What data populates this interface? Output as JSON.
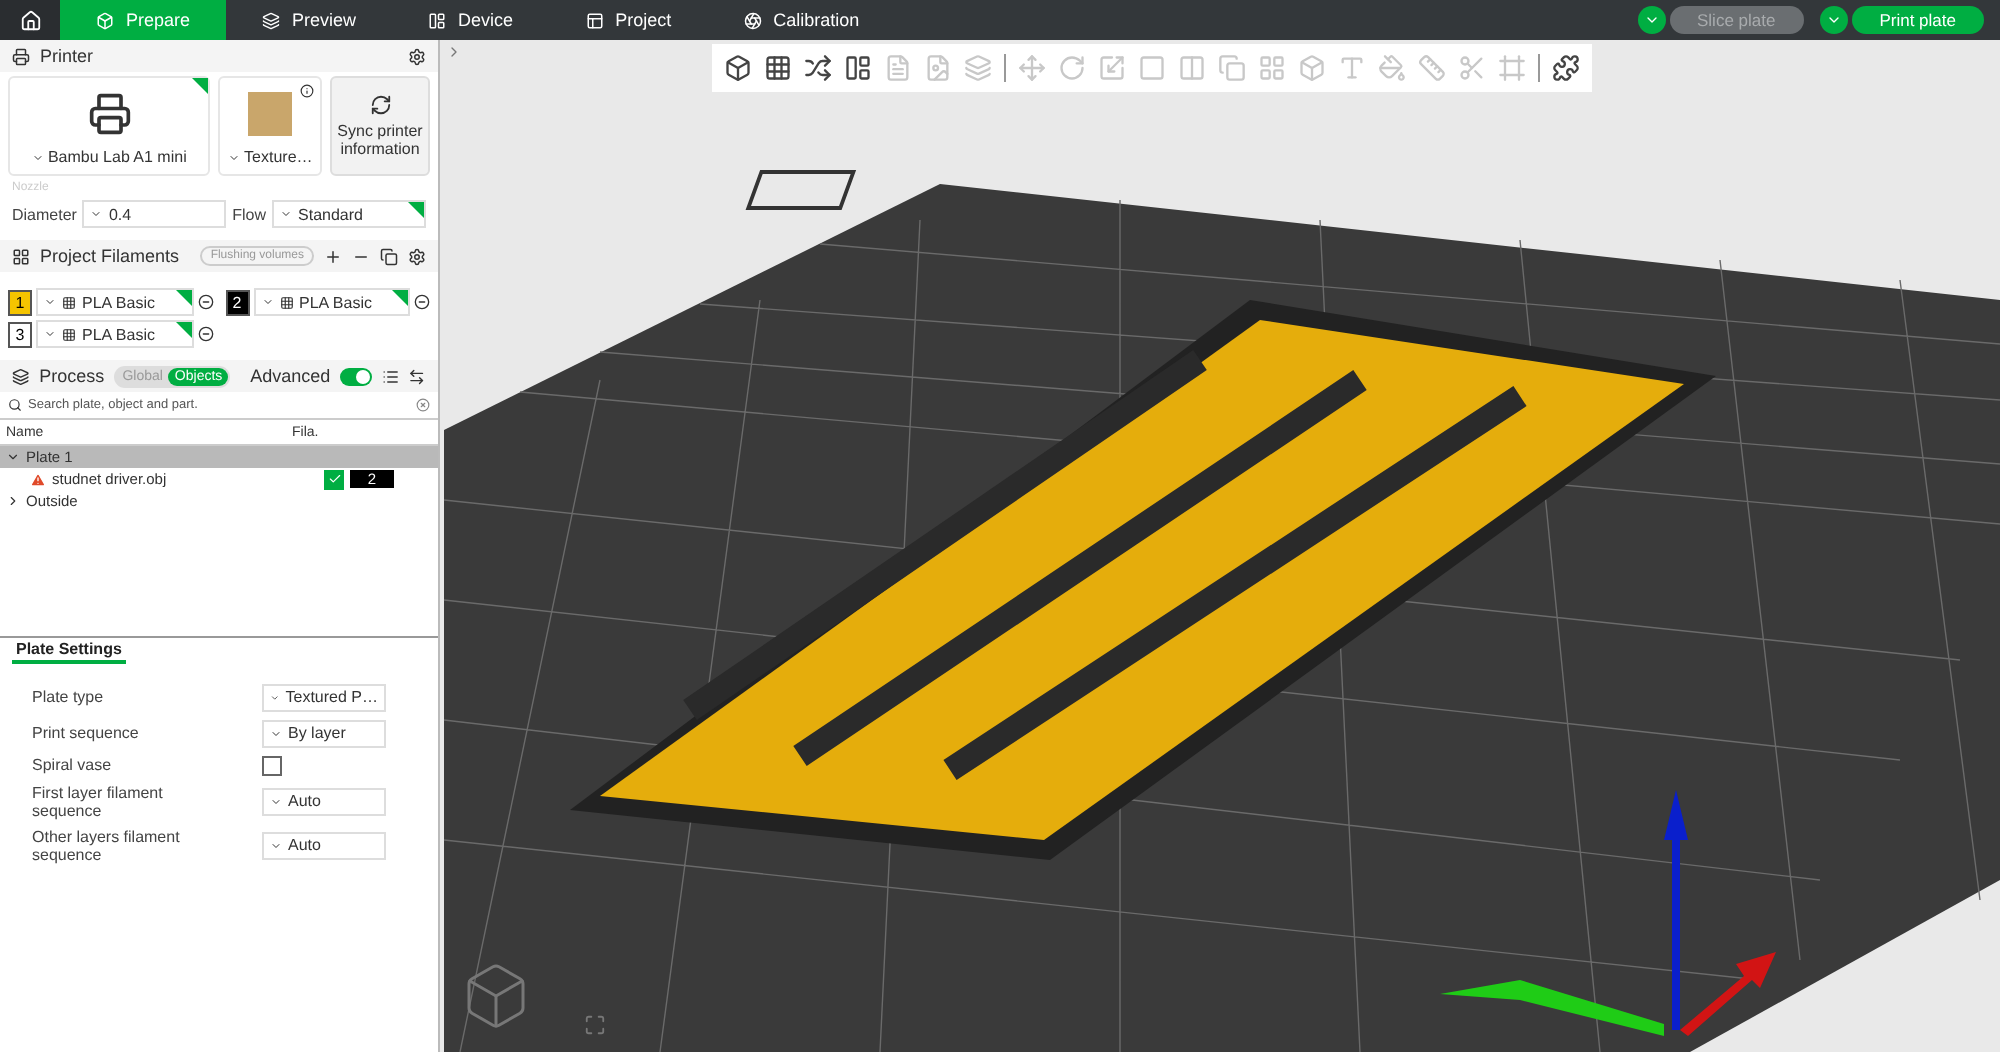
{
  "top_bar": {
    "tabs": [
      {
        "label": "Prepare",
        "selected": true
      },
      {
        "label": "Preview",
        "selected": false
      },
      {
        "label": "Device",
        "selected": false
      },
      {
        "label": "Project",
        "selected": false
      },
      {
        "label": "Calibration",
        "selected": false
      }
    ],
    "buttons": [
      {
        "label": "Slice plate",
        "disabled": true
      },
      {
        "label": "Print plate",
        "disabled": false
      }
    ]
  },
  "printer": {
    "title": "Printer",
    "printer_name": "Bambu Lab A1 mini",
    "plate_name": "Texture…",
    "sync_label": "Sync printer information",
    "nozzle_label": "Nozzle",
    "diameter_label": "Diameter",
    "diameter_value": "0.4",
    "flow_label": "Flow",
    "flow_value": "Standard"
  },
  "filaments": {
    "title": "Project Filaments",
    "flushing_button": "Flushing volumes",
    "items": [
      {
        "number": "1",
        "color": "#f5c400",
        "name": "PLA Basic"
      },
      {
        "number": "2",
        "color": "#000000",
        "name": "PLA Basic"
      },
      {
        "number": "3",
        "color": "#ffffff",
        "name": "PLA Basic"
      }
    ]
  },
  "process": {
    "title": "Process",
    "modes": [
      {
        "label": "Global",
        "selected": false
      },
      {
        "label": "Objects",
        "selected": true
      }
    ],
    "advanced_label": "Advanced",
    "advanced_on": true,
    "search_placeholder": "Search plate, object and part.",
    "columns": [
      "Name",
      "Fila."
    ],
    "tree": [
      {
        "label": "Plate 1",
        "expanded": true,
        "children": [
          {
            "label": "studnet driver.obj",
            "warning": true,
            "checked": true,
            "filament": "2"
          }
        ]
      },
      {
        "label": "Outside",
        "expanded": false
      }
    ]
  },
  "plate_settings": {
    "tab": "Plate Settings",
    "rows": [
      {
        "kind": "select",
        "label": "Plate type",
        "value": "Textured P…"
      },
      {
        "kind": "select",
        "label": "Print sequence",
        "value": "By layer"
      },
      {
        "kind": "checkbox",
        "label": "Spiral vase",
        "checked": false
      },
      {
        "kind": "select",
        "label": "First layer filament sequence",
        "value": "Auto"
      },
      {
        "kind": "select",
        "label": "Other layers filament sequence",
        "value": "Auto"
      }
    ]
  },
  "toolbar": {
    "tools": [
      {
        "disabled": false
      },
      {
        "disabled": false
      },
      {
        "disabled": false
      },
      {
        "disabled": false
      },
      {
        "disabled": true
      },
      {
        "disabled": true
      },
      {
        "disabled": true
      },
      {
        "disabled": true
      },
      {
        "disabled": true
      },
      {
        "disabled": true
      },
      {
        "disabled": true
      },
      {
        "disabled": true
      },
      {
        "disabled": true
      },
      {
        "disabled": true
      },
      {
        "disabled": true
      },
      {
        "disabled": true
      },
      {
        "disabled": true
      },
      {
        "disabled": true
      },
      {
        "disabled": true
      },
      {
        "disabled": true
      },
      {
        "disabled": false
      }
    ]
  }
}
